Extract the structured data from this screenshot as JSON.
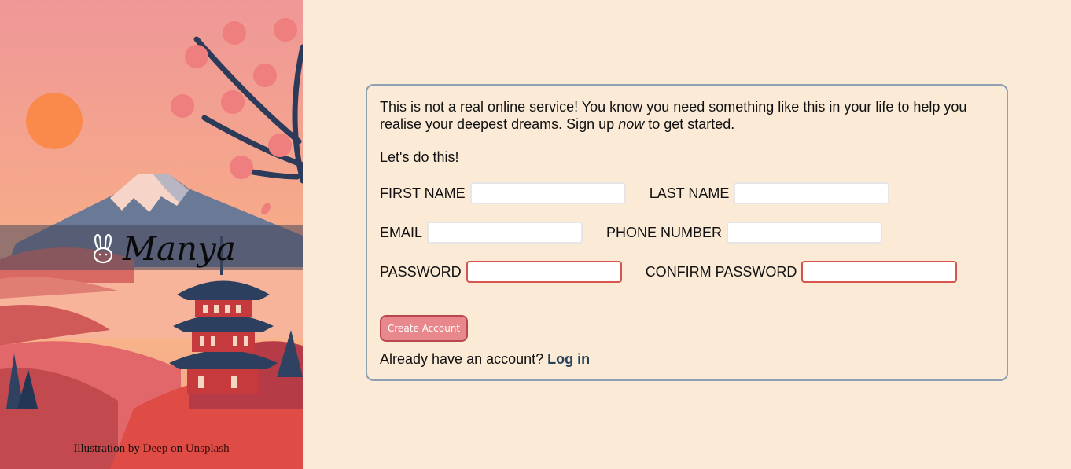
{
  "brand": {
    "name": "Manya",
    "logo_icon": "rabbit-icon"
  },
  "credit": {
    "prefix": "Illustration by",
    "author": "Deep",
    "middle": "on",
    "source": "Unsplash"
  },
  "intro": {
    "text_before": "This is not a real online service! You know you need something like this in your life to help you realise your deepest dreams. Sign up",
    "emphasis": "now",
    "text_after": "to get started.",
    "call": "Let's do this!"
  },
  "form": {
    "first_name_label": "FIRST NAME",
    "last_name_label": "LAST NAME",
    "email_label": "EMAIL",
    "phone_label": "PHONE NUMBER",
    "password_label": "PASSWORD",
    "confirm_password_label": "CONFIRM PASSWORD",
    "first_name_value": "",
    "last_name_value": "",
    "email_value": "",
    "phone_value": "",
    "password_value": "",
    "confirm_password_value": "",
    "submit_label": "Create Account"
  },
  "login": {
    "prompt": "Already have an account?",
    "link": "Log in"
  },
  "colors": {
    "page_bg": "#faead6",
    "card_border": "#8fa0b4",
    "invalid_border": "#d9534f",
    "button_bg": "#e8878c",
    "button_border": "#b8474f",
    "login_link": "#24425a"
  }
}
